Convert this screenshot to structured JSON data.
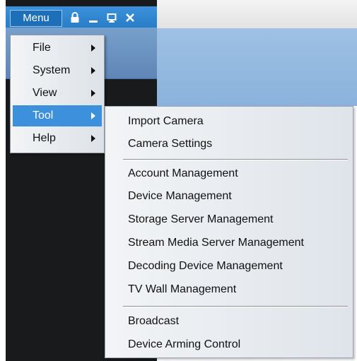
{
  "window": {
    "menu_label": "Menu",
    "icons": [
      "lock-icon",
      "minimize-icon",
      "restore-icon",
      "close-icon"
    ]
  },
  "main_menu": {
    "items": [
      {
        "label": "File",
        "has_submenu": true,
        "active": false
      },
      {
        "label": "System",
        "has_submenu": true,
        "active": false
      },
      {
        "label": "View",
        "has_submenu": true,
        "active": false
      },
      {
        "label": "Tool",
        "has_submenu": true,
        "active": true
      },
      {
        "label": "Help",
        "has_submenu": true,
        "active": false
      }
    ]
  },
  "tool_submenu": {
    "groups": [
      [
        "Import Camera",
        "Camera Settings"
      ],
      [
        "Account Management",
        "Device Management",
        "Storage Server Management",
        "Stream Media Server Management",
        "Decoding Device Management",
        "TV Wall Management"
      ],
      [
        "Broadcast",
        "Device Arming Control"
      ]
    ]
  },
  "colors": {
    "title_bar": "#2a7cc6",
    "active_item": "#3d90dc",
    "dark_background": "#191a1c"
  }
}
